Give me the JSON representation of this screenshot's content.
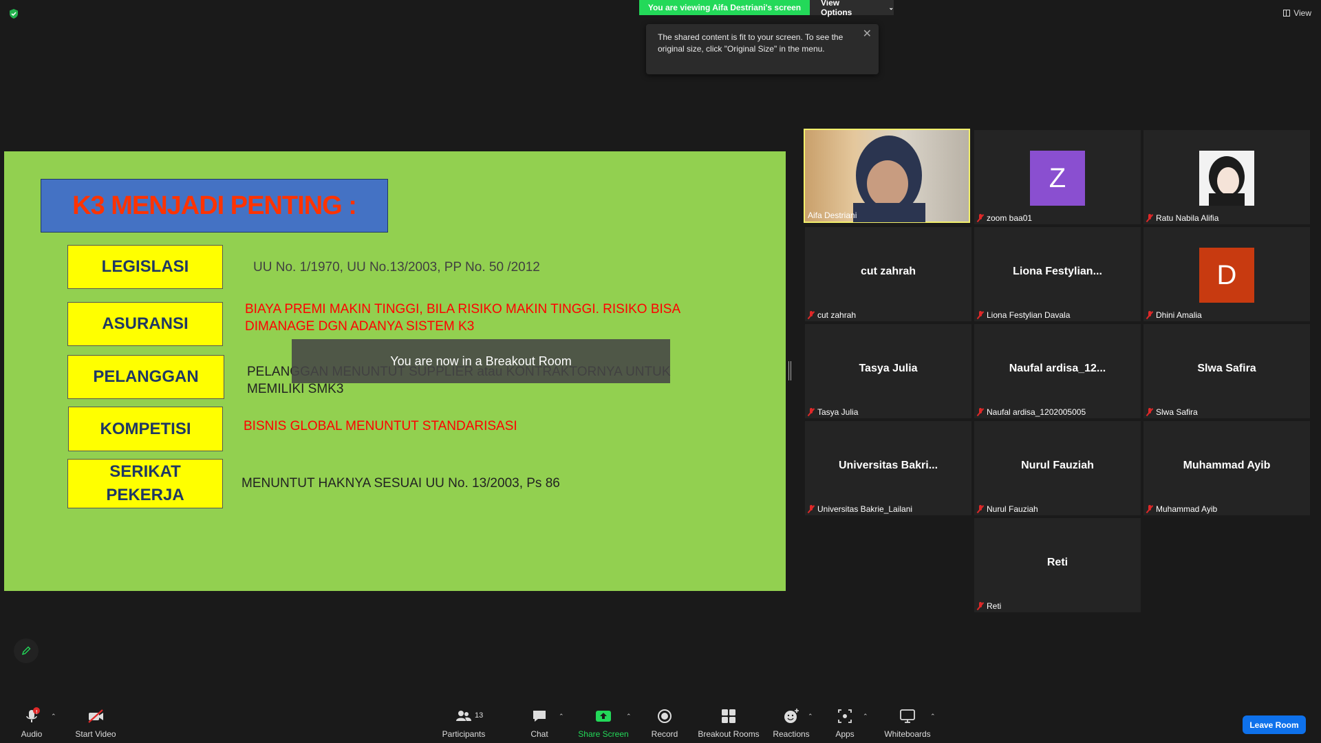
{
  "topbar": {
    "viewing_banner": "You are viewing Aifa Destriani's screen",
    "view_options_label": "View Options",
    "view_label": "View"
  },
  "tooltip": {
    "text": "The shared content is fit to your screen. To see the original size, click \"Original Size\" in the menu."
  },
  "slide": {
    "title": "K3 MENJADI PENTING :",
    "rows": [
      {
        "term": "LEGISLASI",
        "desc": "UU No. 1/1970, UU No.13/2003, PP No. 50 /2012"
      },
      {
        "term": "ASURANSI",
        "desc": "BIAYA PREMI MAKIN TINGGI, BILA RISIKO MAKIN TINGGI. RISIKO BISA DIMANAGE DGN ADANYA SISTEM K3"
      },
      {
        "term": "PELANGGAN",
        "desc": "PELANGGAN MENUNTUT SUPPLIER atau KONTRAKTORNYA UNTUK MEMILIKI SMK3"
      },
      {
        "term": "KOMPETISI",
        "desc": "BISNIS GLOBAL MENUNTUT STANDARISASI"
      },
      {
        "term": "SERIKAT PEKERJA",
        "desc": "MENUNTUT HAKNYA SESUAI UU No. 13/2003, Ps 86"
      }
    ]
  },
  "breakout_toast": "You are now in a Breakout Room",
  "gallery": [
    {
      "center": "",
      "label": "Aifa Destriani",
      "type": "video",
      "muted": false
    },
    {
      "center": "Z",
      "label": "zoom baa01",
      "type": "letter",
      "bg": "#8a4fd0",
      "muted": true
    },
    {
      "center": "",
      "label": "Ratu Nabila Alifia",
      "type": "photo",
      "muted": true
    },
    {
      "center": "cut zahrah",
      "label": "cut zahrah",
      "type": "name",
      "muted": true
    },
    {
      "center": "Liona  Festylian...",
      "label": "Liona Festylian Davala",
      "type": "name",
      "muted": true
    },
    {
      "center": "D",
      "label": "Dhini Amalia",
      "type": "letter",
      "bg": "#c83a10",
      "muted": true
    },
    {
      "center": "Tasya Julia",
      "label": "Tasya Julia",
      "type": "name",
      "muted": true
    },
    {
      "center": "Naufal  ardisa_12...",
      "label": "Naufal ardisa_1202005005",
      "type": "name",
      "muted": true
    },
    {
      "center": "Slwa Safira",
      "label": "Slwa Safira",
      "type": "name",
      "muted": true
    },
    {
      "center": "Universitas  Bakri...",
      "label": "Universitas Bakrie_Lailani",
      "type": "name",
      "muted": true
    },
    {
      "center": "Nurul Fauziah",
      "label": "Nurul Fauziah",
      "type": "name",
      "muted": true
    },
    {
      "center": "Muhammad Ayib",
      "label": "Muhammad Ayib",
      "type": "name",
      "muted": true
    },
    {
      "center": "Reti",
      "label": "Reti",
      "type": "name",
      "muted": true
    }
  ],
  "toolbar": {
    "audio": "Audio",
    "audio_badge": "!",
    "start_video": "Start Video",
    "participants": "Participants",
    "participants_count": "13",
    "chat": "Chat",
    "share_screen": "Share Screen",
    "record": "Record",
    "breakout_rooms": "Breakout Rooms",
    "reactions": "Reactions",
    "apps": "Apps",
    "whiteboards": "Whiteboards",
    "leave_room": "Leave Room"
  },
  "colors": {
    "slide_bg": "#92d050",
    "title_bg": "#4472c4",
    "title_text": "#ff3300",
    "term_bg": "#ffff00",
    "share_green": "#23d959",
    "leave_blue": "#0e71eb",
    "active_border": "#f3f06b"
  }
}
